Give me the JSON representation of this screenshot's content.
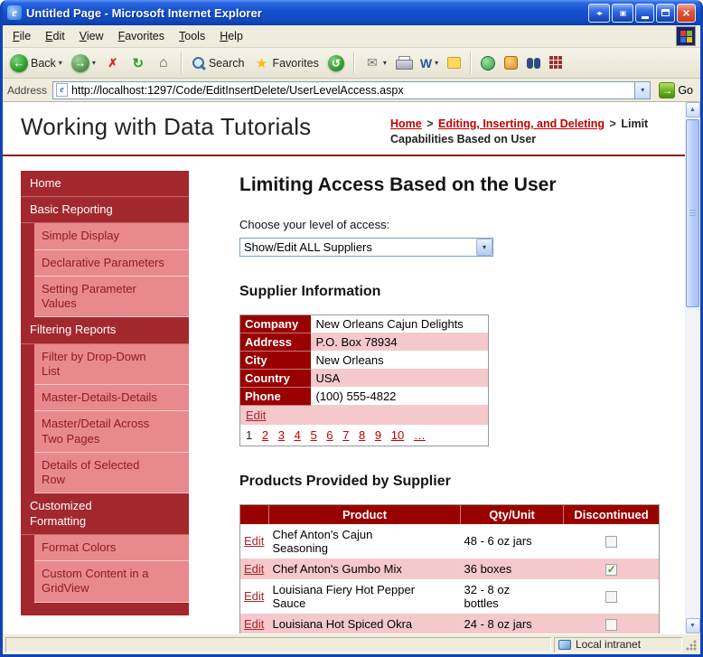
{
  "window": {
    "title": "Untitled Page - Microsoft Internet Explorer"
  },
  "menubar": {
    "items": [
      "File",
      "Edit",
      "View",
      "Favorites",
      "Tools",
      "Help"
    ]
  },
  "toolbar": {
    "back": "Back",
    "search": "Search",
    "favorites": "Favorites"
  },
  "addressbar": {
    "label": "Address",
    "url": "http://localhost:1297/Code/EditInsertDelete/UserLevelAccess.aspx",
    "go": "Go"
  },
  "icons": {
    "ie_logo": "e",
    "nav_pair": "◂▸",
    "panel": "▣",
    "close": "×",
    "back_arrow": "←",
    "forward_arrow": "→",
    "stop": "✗",
    "refresh": "↻",
    "home": "⌂",
    "star": "★",
    "history": "↺",
    "mail": "✉",
    "word": "W",
    "dropdown": "▾",
    "go_arrow": "→",
    "arrow_up": "▲",
    "arrow_down": "▼"
  },
  "page": {
    "site_title": "Working with Data Tutorials",
    "breadcrumb": {
      "home": "Home",
      "separator": ">",
      "section": "Editing, Inserting, and Deleting",
      "current": "Limit Capabilities Based on User"
    },
    "sidebar": [
      {
        "label": "Home",
        "level": "parent"
      },
      {
        "label": "Basic Reporting",
        "level": "parent"
      },
      {
        "label": "Simple Display",
        "level": "child"
      },
      {
        "label": "Declarative Parameters",
        "level": "child"
      },
      {
        "label": "Setting Parameter Values",
        "level": "child"
      },
      {
        "label": "Filtering Reports",
        "level": "parent"
      },
      {
        "label": "Filter by Drop-Down List",
        "level": "child"
      },
      {
        "label": "Master-Details-Details",
        "level": "child"
      },
      {
        "label": "Master/Detail Across Two Pages",
        "level": "child"
      },
      {
        "label": "Details of Selected Row",
        "level": "child"
      },
      {
        "label": "Customized Formatting",
        "level": "parent"
      },
      {
        "label": "Format Colors",
        "level": "child"
      },
      {
        "label": "Custom Content in a GridView",
        "level": "child"
      }
    ],
    "main": {
      "title": "Limiting Access Based on the User",
      "access_label": "Choose your level of access:",
      "access_value": "Show/Edit ALL Suppliers",
      "supplier_heading": "Supplier Information",
      "supplier": {
        "fields": [
          {
            "name": "Company",
            "value": "New Orleans Cajun Delights"
          },
          {
            "name": "Address",
            "value": "P.O. Box 78934"
          },
          {
            "name": "City",
            "value": "New Orleans"
          },
          {
            "name": "Country",
            "value": "USA"
          },
          {
            "name": "Phone",
            "value": "(100) 555-4822"
          }
        ],
        "edit": "Edit",
        "pager": [
          "1",
          "2",
          "3",
          "4",
          "5",
          "6",
          "7",
          "8",
          "9",
          "10",
          "…"
        ]
      },
      "products_heading": "Products Provided by Supplier",
      "products": {
        "headers": {
          "edit": "",
          "product": "Product",
          "qty": "Qty/Unit",
          "disc": "Discontinued"
        },
        "rows": [
          {
            "edit": "Edit",
            "product": "Chef Anton's Cajun Seasoning",
            "qty": "48 - 6 oz jars",
            "disc": false
          },
          {
            "edit": "Edit",
            "product": "Chef Anton's Gumbo Mix",
            "qty": "36 boxes",
            "disc": true
          },
          {
            "edit": "Edit",
            "product": "Louisiana Fiery Hot Pepper Sauce",
            "qty": "32 - 8 oz bottles",
            "disc": false
          },
          {
            "edit": "Edit",
            "product": "Louisiana Hot Spiced Okra",
            "qty": "24 - 8 oz jars",
            "disc": false
          }
        ]
      }
    }
  },
  "statusbar": {
    "right": "Local intranet"
  },
  "colors": {
    "xp_titlebar_blue": "#1450cf",
    "sidebar_dark_red": "#A3282D",
    "sidebar_pink": "#E8898D",
    "table_header_red": "#990000",
    "row_pink": "#F5C9CB",
    "link_red": "#C00000",
    "go_green": "#6FB320"
  }
}
